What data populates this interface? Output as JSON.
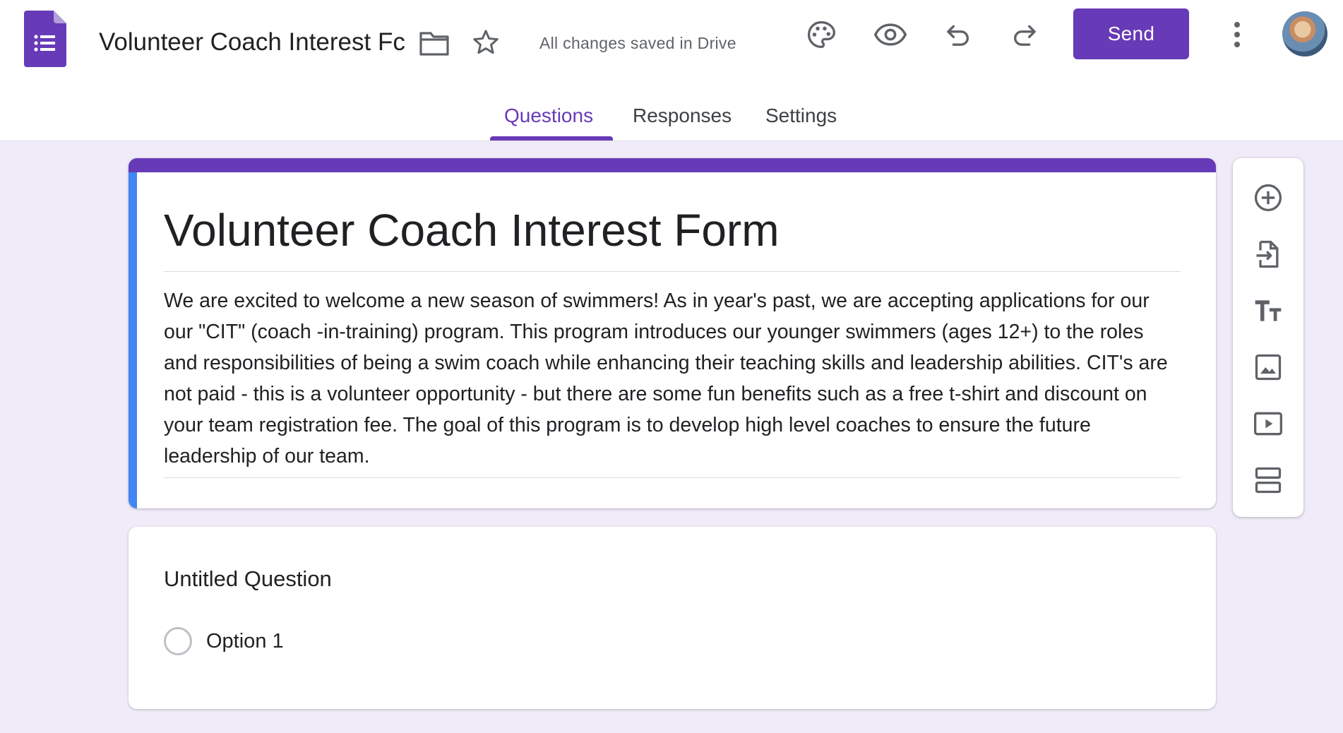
{
  "header": {
    "doc_title": "Volunteer Coach Interest Fc",
    "saved_status": "All changes saved in Drive",
    "send_label": "Send",
    "icons": [
      "forms-logo-icon",
      "folder-icon",
      "star-icon",
      "palette-icon",
      "eye-icon",
      "undo-icon",
      "redo-icon",
      "more-vert-icon",
      "avatar"
    ]
  },
  "tabs": [
    {
      "label": "Questions",
      "active": true
    },
    {
      "label": "Responses",
      "active": false
    },
    {
      "label": "Settings",
      "active": false
    }
  ],
  "form": {
    "title": "Volunteer Coach Interest Form",
    "description": "We are excited to welcome a new season of swimmers!  As in year's past, we are accepting applications for our our \"CIT\" (coach -in-training) program.  This program introduces our younger swimmers (ages 12+) to the roles and responsibilities of being a swim coach while enhancing their teaching skills and leadership abilities. CIT's are not paid - this is a volunteer opportunity - but there are some fun benefits such as a free t-shirt and discount on your team registration fee.  The goal of this program is to develop high level coaches to ensure the future leadership of our team."
  },
  "question": {
    "title": "Untitled Question",
    "options": [
      "Option 1"
    ]
  },
  "toolbar": {
    "tools": [
      "add-question-icon",
      "import-questions-icon",
      "add-title-icon",
      "add-image-icon",
      "add-video-icon",
      "add-section-icon"
    ]
  },
  "colors": {
    "accent": "#673ab7",
    "background": "#f0ebf8",
    "card_left_bar": "#4285f4"
  }
}
